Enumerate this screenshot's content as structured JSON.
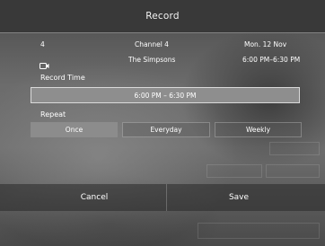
{
  "dialog": {
    "title": "Record"
  },
  "program": {
    "channel_number": "4",
    "channel_name": "Channel 4",
    "date": "Mon. 12 Nov",
    "icon": "tv-record-icon",
    "show_title": "The Simpsons",
    "show_time": "6:00 PM–6:30 PM"
  },
  "record_time": {
    "label": "Record Time",
    "value": "6:00 PM – 6:30 PM"
  },
  "repeat": {
    "label": "Repeat",
    "options": [
      {
        "label": "Once",
        "selected": true
      },
      {
        "label": "Everyday",
        "selected": false
      },
      {
        "label": "Weekly",
        "selected": false
      }
    ]
  },
  "actions": {
    "cancel_label": "Cancel",
    "save_label": "Save"
  },
  "colors": {
    "title_bar": "#393939",
    "selected_option": "#8c8c8c",
    "time_field": "#8e8e8e",
    "text": "#ffffff"
  }
}
